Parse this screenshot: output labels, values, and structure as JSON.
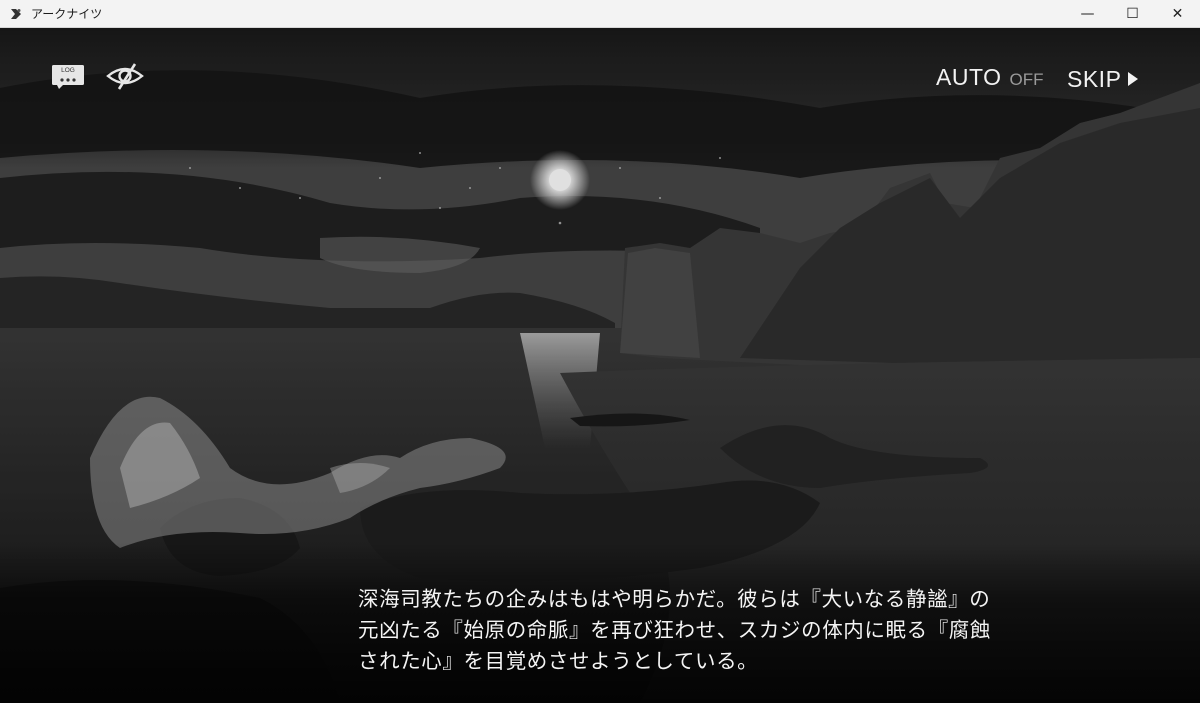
{
  "window": {
    "title": "アークナイツ",
    "app_icon": "arknights-logo-icon",
    "controls": [
      "minimize-icon",
      "maximize-icon",
      "close-icon"
    ],
    "minimize_glyph": "—",
    "maximize_glyph": "☐",
    "close_glyph": "✕"
  },
  "hud": {
    "log_label": "LOG",
    "log_icon": "log-icon",
    "hide_ui_icon": "eye-slash-icon",
    "auto_label": "AUTO",
    "auto_state": "OFF",
    "skip_label": "SKIP",
    "skip_icon": "play-triangle-icon"
  },
  "dialogue": {
    "lines": [
      "深海司教たちの企みはもはや明らかだ。彼らは『大いなる静謐』の",
      "元凶たる『始原の命脈』を再び狂わせ、スカジの体内に眠る『腐蝕",
      "された心』を目覚めさせようとしている。"
    ]
  },
  "colors": {
    "titlebar_bg": "#f3f3f3",
    "hud_text": "#f2f2f2",
    "auto_off": "#9a9a9a",
    "dialogue_text": "#f4f4f4"
  }
}
